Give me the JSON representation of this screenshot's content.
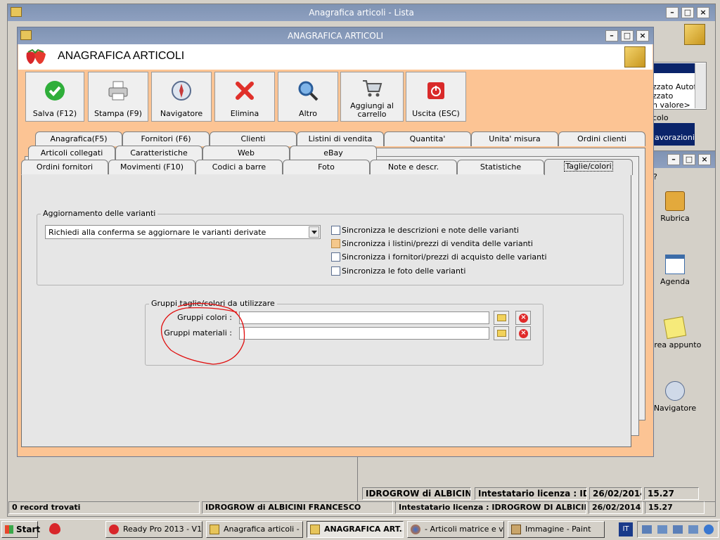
{
  "bg_window": {
    "title": "Anagrafica articoli  - Lista",
    "status_count": "0 record trovati",
    "status_company": "IDROGROW di ALBICINI FRANCESCO",
    "status_license": "Intestatario licenza : IDROGROW DI ALBICINI FR",
    "status_date": "26/02/2014",
    "status_time": "15.27",
    "side_list": [
      "zzato Autofi",
      "zzato",
      "n valore>"
    ],
    "side_label": "colo",
    "side_sel": "lavorazioni"
  },
  "right_window": {
    "question": "?",
    "icons": [
      {
        "label": "Rubrica",
        "icon": "address-book-icon"
      },
      {
        "label": "Agenda",
        "icon": "calendar-icon"
      },
      {
        "label": "Crea appunto",
        "icon": "note-icon"
      },
      {
        "label": "Navigatore",
        "icon": "compass-icon"
      }
    ],
    "status_company": "IDROGROW di ALBICINI F",
    "status_license": "Intestatario licenza : IDROG",
    "status_date": "26/02/2014",
    "status_time": "15.27"
  },
  "main_window": {
    "title": "ANAGRAFICA ARTICOLI",
    "heading": "ANAGRAFICA ARTICOLI",
    "toolbar": {
      "save": "Salva (F12)",
      "print": "Stampa (F9)",
      "navigator": "Navigatore",
      "delete": "Elimina",
      "other": "Altro",
      "cart_l1": "Aggiungi al",
      "cart_l2": "carrello",
      "exit": "Uscita (ESC)"
    },
    "tabs_row1": [
      "Anagrafica(F5)",
      "Fornitori (F6)",
      "Clienti",
      "Listini di vendita",
      "Quantita'",
      "Unita' misura",
      "Ordini clienti"
    ],
    "tabs_row2": [
      "Articoli collegati",
      "Caratteristiche",
      "Web",
      "eBay"
    ],
    "tabs_row3": [
      "Ordini fornitori",
      "Movimenti (F10)",
      "Codici a barre",
      "Foto",
      "Note e descr.",
      "Statistiche",
      "Taglie/colori"
    ],
    "variants_group": {
      "title": "Aggiornamento delle varianti",
      "dropdown_value": "Richiedi alla conferma se aggiornare le varianti derivate",
      "checkboxes": [
        "Sincronizza le descrizioni e note delle varianti",
        "Sincronizza i listini/prezzi di vendita delle varianti",
        "Sincronizza i fornitori/prezzi di acquisto delle varianti",
        "Sincronizza le foto delle varianti"
      ]
    },
    "groups_section": {
      "title": "Gruppi taglie/colori da utilizzare",
      "colors_label": "Gruppi colori :",
      "colors_value": "",
      "materials_label": "Gruppi materiali :",
      "materials_value": ""
    }
  },
  "taskbar": {
    "start": "Start",
    "items": [
      "Ready Pro 2013 - V1...",
      "Anagrafica articoli  - ...",
      "ANAGRAFICA ART...",
      "- Articoli matrice e v...",
      "Immagine - Paint"
    ],
    "lang": "IT"
  },
  "colors": {
    "accent_orange": "#fcc494",
    "title_blue": "#8397b8",
    "annotation_red": "#e01010"
  }
}
